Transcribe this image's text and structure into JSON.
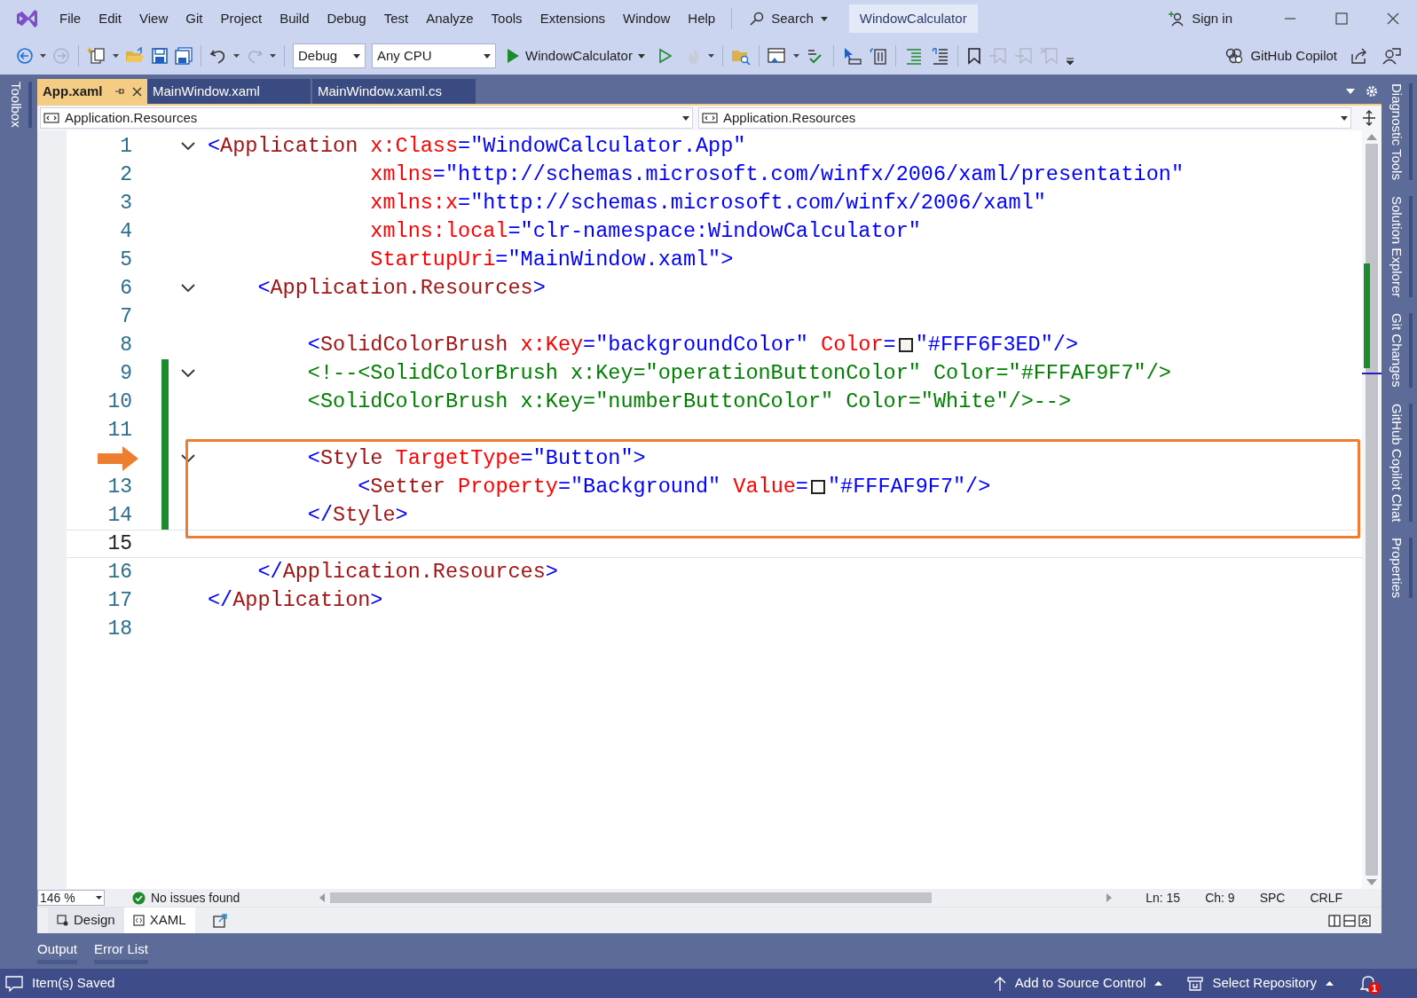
{
  "menu": [
    "File",
    "Edit",
    "View",
    "Git",
    "Project",
    "Build",
    "Debug",
    "Test",
    "Analyze",
    "Tools",
    "Extensions",
    "Window",
    "Help"
  ],
  "search": {
    "label": "Search"
  },
  "solution_title": "WindowCalculator",
  "sign_in": "Sign in",
  "toolbar": {
    "configuration": "Debug",
    "platform": "Any CPU",
    "start": "WindowCalculator",
    "copilot": "GitHub Copilot"
  },
  "tabs": [
    {
      "label": "App.xaml",
      "selected": true
    },
    {
      "label": "MainWindow.xaml",
      "selected": false
    },
    {
      "label": "MainWindow.xaml.cs",
      "selected": false
    }
  ],
  "annotation": {
    "arrow": true
  },
  "nav": {
    "left": "Application.Resources",
    "right": "Application.Resources"
  },
  "lines": [
    {
      "number": "1",
      "fold": true,
      "changed": false,
      "current": false,
      "boxed": false,
      "tokens": [
        {
          "kind": "bracket",
          "text": "<"
        },
        {
          "kind": "tag",
          "text": "Application"
        },
        {
          "kind": "attr",
          "text": " x:Class"
        },
        {
          "kind": "value",
          "text": "=\"WindowCalculator.App\""
        }
      ]
    },
    {
      "number": "2",
      "fold": false,
      "changed": false,
      "current": false,
      "boxed": false,
      "tokens": [
        {
          "kind": "attr",
          "text": "             xmlns"
        },
        {
          "kind": "value",
          "text": "=\"http://schemas.microsoft.com/winfx/2006/xaml/presentation\""
        }
      ]
    },
    {
      "number": "3",
      "fold": false,
      "changed": false,
      "current": false,
      "boxed": false,
      "tokens": [
        {
          "kind": "attr",
          "text": "             xmlns:x"
        },
        {
          "kind": "value",
          "text": "=\"http://schemas.microsoft.com/winfx/2006/xaml\""
        }
      ]
    },
    {
      "number": "4",
      "fold": false,
      "changed": false,
      "current": false,
      "boxed": false,
      "tokens": [
        {
          "kind": "attr",
          "text": "             xmlns:local"
        },
        {
          "kind": "value",
          "text": "=\"clr-namespace:WindowCalculator\""
        }
      ]
    },
    {
      "number": "5",
      "fold": false,
      "changed": false,
      "current": false,
      "boxed": false,
      "tokens": [
        {
          "kind": "attr",
          "text": "             StartupUri"
        },
        {
          "kind": "value",
          "text": "=\"MainWindow.xaml\">"
        }
      ]
    },
    {
      "number": "6",
      "fold": true,
      "changed": false,
      "current": false,
      "boxed": false,
      "tokens": [
        {
          "kind": "bracket",
          "text": "    <"
        },
        {
          "kind": "tag",
          "text": "Application.Resources"
        },
        {
          "kind": "bracket",
          "text": ">"
        }
      ]
    },
    {
      "number": "7",
      "fold": false,
      "changed": false,
      "current": false,
      "boxed": false
    },
    {
      "number": "8",
      "fold": false,
      "changed": false,
      "current": false,
      "boxed": false,
      "tokens": [
        {
          "kind": "bracket",
          "text": "        <"
        },
        {
          "kind": "tag",
          "text": "SolidColorBrush"
        },
        {
          "kind": "attr",
          "text": " x:Key"
        },
        {
          "kind": "value",
          "text": "=\"backgroundColor\""
        },
        {
          "kind": "attr",
          "text": " Color"
        },
        {
          "kind": "value",
          "text": "="
        },
        {
          "kind": "swatch",
          "color": "#f6f3ed"
        },
        {
          "kind": "value",
          "text": "\"#FFF6F3ED\"/>"
        }
      ]
    },
    {
      "number": "9",
      "fold": true,
      "changed": true,
      "current": false,
      "boxed": false,
      "tokens": [
        {
          "kind": "comment",
          "text": "        <!--<SolidColorBrush x:Key=\"operationButtonColor\" Color=\"#FFFAF9F7\"/>"
        }
      ]
    },
    {
      "number": "10",
      "fold": false,
      "changed": true,
      "current": false,
      "boxed": false,
      "tokens": [
        {
          "kind": "comment",
          "text": "        <SolidColorBrush x:Key=\"numberButtonColor\" Color=\"White\"/>-->"
        }
      ]
    },
    {
      "number": "11",
      "fold": false,
      "changed": true,
      "current": false,
      "boxed": false
    },
    {
      "fold": true,
      "changed": true,
      "current": false,
      "boxed": true,
      "tokens": [
        {
          "kind": "bracket",
          "text": "        <"
        },
        {
          "kind": "tag",
          "text": "Style"
        },
        {
          "kind": "attr",
          "text": " TargetType"
        },
        {
          "kind": "value",
          "text": "=\"Button\">"
        }
      ]
    },
    {
      "number": "13",
      "fold": false,
      "changed": true,
      "current": false,
      "boxed": true,
      "tokens": [
        {
          "kind": "bracket",
          "text": "            <"
        },
        {
          "kind": "tag",
          "text": "Setter"
        },
        {
          "kind": "attr",
          "text": " Property"
        },
        {
          "kind": "value",
          "text": "=\"Background\""
        },
        {
          "kind": "attr",
          "text": " Value"
        },
        {
          "kind": "value",
          "text": "="
        },
        {
          "kind": "swatch",
          "color": "#faf9f7"
        },
        {
          "kind": "value",
          "text": "\"#FFFAF9F7\"/>"
        }
      ]
    },
    {
      "number": "14",
      "fold": false,
      "changed": true,
      "current": false,
      "boxed": true,
      "tokens": [
        {
          "kind": "bracket",
          "text": "        </"
        },
        {
          "kind": "tag",
          "text": "Style"
        },
        {
          "kind": "bracket",
          "text": ">"
        }
      ]
    },
    {
      "number": "15",
      "fold": false,
      "changed": false,
      "current": true,
      "boxed": false
    },
    {
      "number": "16",
      "fold": false,
      "changed": false,
      "current": false,
      "boxed": false,
      "tokens": [
        {
          "kind": "bracket",
          "text": "    </"
        },
        {
          "kind": "tag",
          "text": "Application.Resources"
        },
        {
          "kind": "bracket",
          "text": ">"
        }
      ]
    },
    {
      "number": "17",
      "fold": false,
      "changed": false,
      "current": false,
      "boxed": false,
      "tokens": [
        {
          "kind": "bracket",
          "text": "</"
        },
        {
          "kind": "tag",
          "text": "Application"
        },
        {
          "kind": "bracket",
          "text": ">"
        }
      ]
    },
    {
      "number": "18",
      "fold": false,
      "changed": false,
      "current": false,
      "boxed": false
    }
  ],
  "editor_status": {
    "zoom": "146 %",
    "issues": "No issues found",
    "line": "Ln: 15",
    "column": "Ch: 9",
    "whitespace": "SPC",
    "line_endings": "CRLF"
  },
  "view_tabs": [
    {
      "label": "Design",
      "selected": false
    },
    {
      "label": "XAML",
      "selected": true
    }
  ],
  "tool_tabs": [
    "Output",
    "Error List"
  ],
  "left_side_tabs": [
    "Toolbox"
  ],
  "right_side_tabs": [
    "Diagnostic Tools",
    "Solution Explorer",
    "Git Changes",
    "GitHub Copilot Chat",
    "Properties"
  ],
  "status_bar": {
    "message": "Item(s) Saved",
    "source_control": "Add to Source Control",
    "repository": "Select Repository",
    "notifications": "1"
  }
}
